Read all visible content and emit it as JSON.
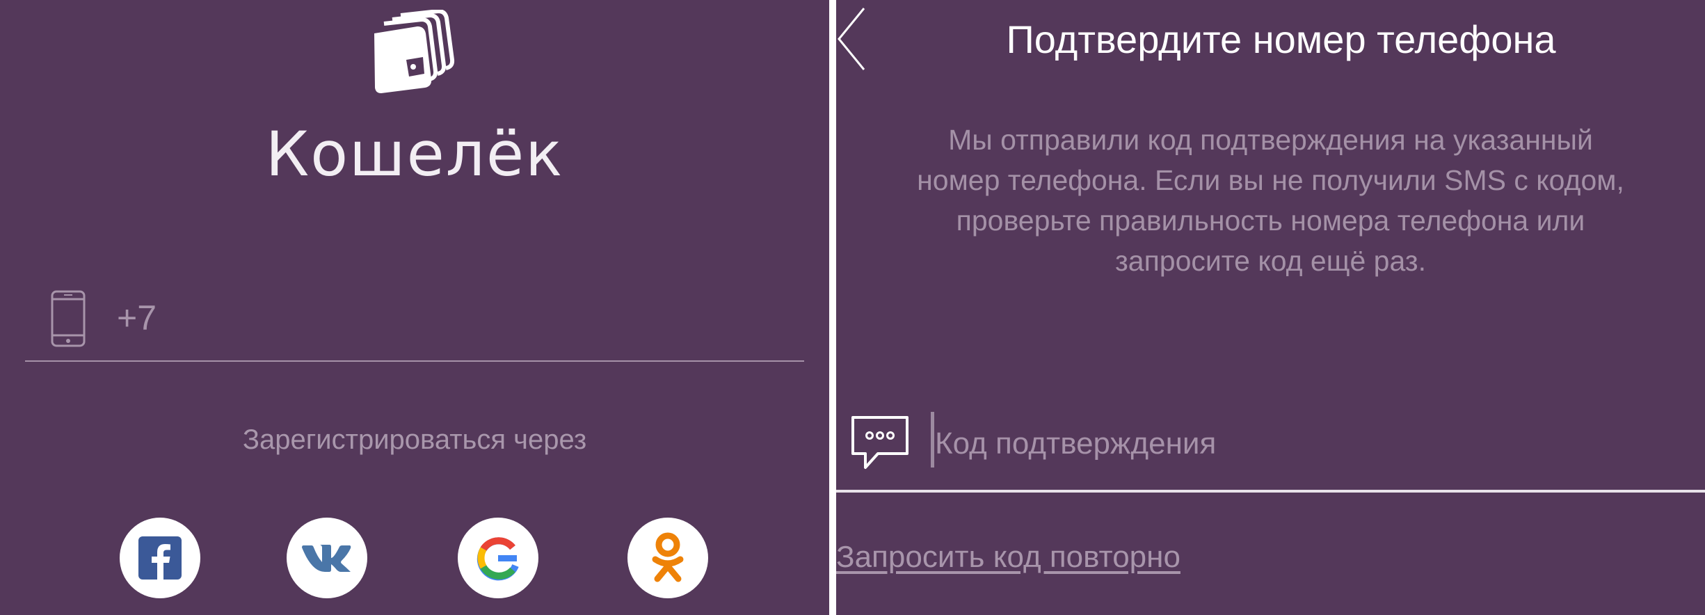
{
  "colors": {
    "background": "#54385a",
    "divider": "#ffffff",
    "muted_text": "#a895ab",
    "facebook_blue": "#3b5998",
    "vk_blue": "#4a76a8",
    "ok_orange": "#ee8208"
  },
  "login_screen": {
    "logo_icon": "wallet-cards-icon",
    "brand_name": "Кошелёк",
    "phone_field": {
      "icon": "smartphone-icon",
      "value": "+7"
    },
    "register_via_label": "Зарегистрироваться через",
    "social_buttons": [
      {
        "icon": "facebook-icon",
        "glyph": "f"
      },
      {
        "icon": "vk-icon",
        "glyph": "vk"
      },
      {
        "icon": "google-icon",
        "glyph": "G"
      },
      {
        "icon": "odnoklassniki-icon",
        "glyph": "ok"
      }
    ]
  },
  "confirm_screen": {
    "back_icon": "chevron-left-icon",
    "title": "Подтвердите номер телефона",
    "description_lines": [
      "Мы отправили код подтверждения на указанный",
      "номер телефона. Если вы не получили SMS с кодом,",
      "проверьте правильность номера телефона или",
      "запросите код ещё раз."
    ],
    "code_field": {
      "icon": "message-bubble-icon",
      "placeholder": "Код подтверждения",
      "value": ""
    },
    "resend_link": "Запросить код повторно"
  }
}
